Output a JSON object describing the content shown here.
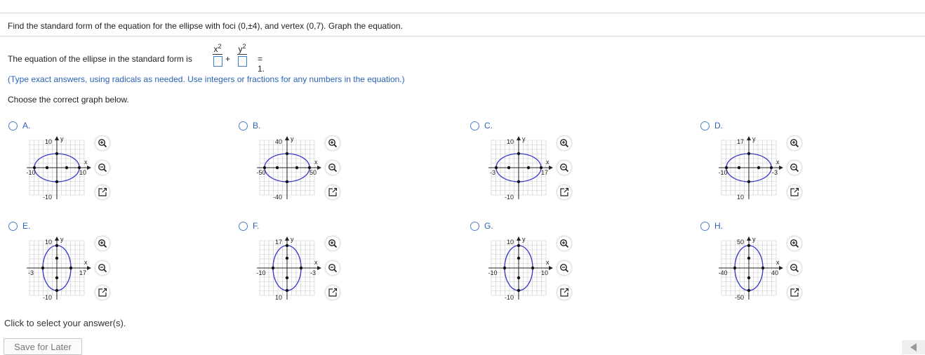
{
  "question": {
    "text": "Find the standard form of the equation for the ellipse with foci (0,±4), and vertex (0,7). Graph the equation."
  },
  "equation": {
    "lead": "The equation of the ellipse in the standard form is",
    "num_x": "x",
    "num_y": "y",
    "exponent": "2",
    "plus": "+",
    "equals": "= 1."
  },
  "hint": "(Type exact answers, using radicals as needed. Use integers or fractions for any numbers in the equation.)",
  "choose": "Choose the correct graph below.",
  "options": [
    {
      "letter": "A.",
      "ellipse": "horizontal",
      "labels": [
        "10",
        "-10",
        "10",
        "-10"
      ],
      "axis_x": "x",
      "axis_y": "y"
    },
    {
      "letter": "B.",
      "ellipse": "horizontal",
      "labels": [
        "40",
        "-50",
        "50",
        "-40"
      ],
      "axis_x": "x",
      "axis_y": "y"
    },
    {
      "letter": "C.",
      "ellipse": "horizontal",
      "labels": [
        "10",
        "-3",
        "17",
        "-10"
      ],
      "axis_x": "x",
      "axis_y": "y"
    },
    {
      "letter": "D.",
      "ellipse": "horizontal",
      "labels": [
        "17",
        "-10",
        "-3",
        "10"
      ],
      "axis_x": "x",
      "axis_y": "y"
    },
    {
      "letter": "E.",
      "ellipse": "vertical",
      "labels": [
        "10",
        "-3",
        "17",
        "-10"
      ],
      "axis_x": "x",
      "axis_y": "y"
    },
    {
      "letter": "F.",
      "ellipse": "vertical",
      "labels": [
        "17",
        "-10",
        "-3",
        "10"
      ],
      "axis_x": "x",
      "axis_y": "y"
    },
    {
      "letter": "G.",
      "ellipse": "vertical",
      "labels": [
        "10",
        "-10",
        "10",
        "-10"
      ],
      "axis_x": "x",
      "axis_y": "y"
    },
    {
      "letter": "H.",
      "ellipse": "vertical",
      "labels": [
        "50",
        "-40",
        "40",
        "-50"
      ],
      "axis_x": "x",
      "axis_y": "y"
    }
  ],
  "footer": {
    "click_text": "Click to select your answer(s).",
    "save_label": "Save for Later"
  },
  "colors": {
    "ellipse": "#3a3acb",
    "link": "#2a62b4",
    "grid": "#c8c8c8"
  }
}
